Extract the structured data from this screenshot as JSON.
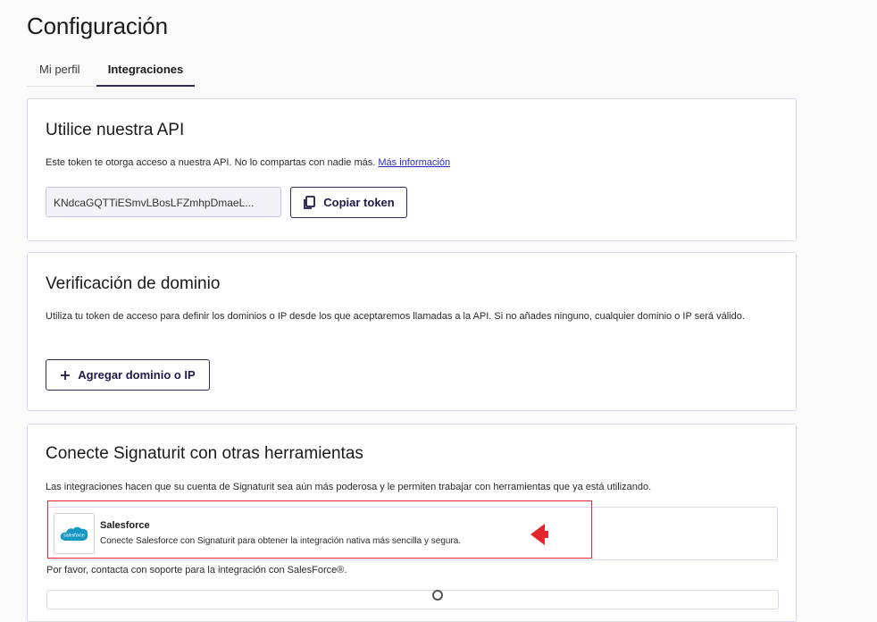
{
  "page": {
    "title": "Configuración"
  },
  "tabs": [
    {
      "label": "Mi perfil",
      "active": false
    },
    {
      "label": "Integraciones",
      "active": true
    }
  ],
  "api_card": {
    "title": "Utilice nuestra API",
    "description": "Este token te otorga acceso a nuestra API. No lo compartas con nadie más.",
    "more_info_link": "Más información",
    "token_value": "KNdcaGQTTiESmvLBosLFZmhpDmaeL...",
    "copy_button_label": "Copiar token",
    "copy_icon": "copy-icon"
  },
  "domain_card": {
    "title": "Verificación de dominio",
    "description": "Utiliza tu token de acceso para definir los dominios o IP desde los que aceptaremos llamadas a la API. Si no añades ninguno, cualquier dominio o IP será válido.",
    "add_button_label": "Agregar dominio o IP",
    "add_icon": "plus-icon"
  },
  "integrations_card": {
    "title": "Conecte Signaturit con otras herramientas",
    "description": "Las integraciones hacen que su cuenta de Signaturit sea aún más poderosa y le permiten trabajar con herramientas que ya está utilizando.",
    "items": [
      {
        "name": "Salesforce",
        "description": "Conecte Salesforce con Signaturit para obtener la integración nativa más sencilla y segura.",
        "logo_text": "salesforce",
        "logo_icon": "salesforce-cloud-icon"
      }
    ],
    "support_note": "Por favor, contacta con soporte para la integración con SalesForce®."
  },
  "colors": {
    "accent": "#2e2a5e",
    "card_border": "#d9d6ee",
    "link": "#2b2bbf",
    "annotation": "#e0282e",
    "salesforce_blue": "#1798c1"
  }
}
